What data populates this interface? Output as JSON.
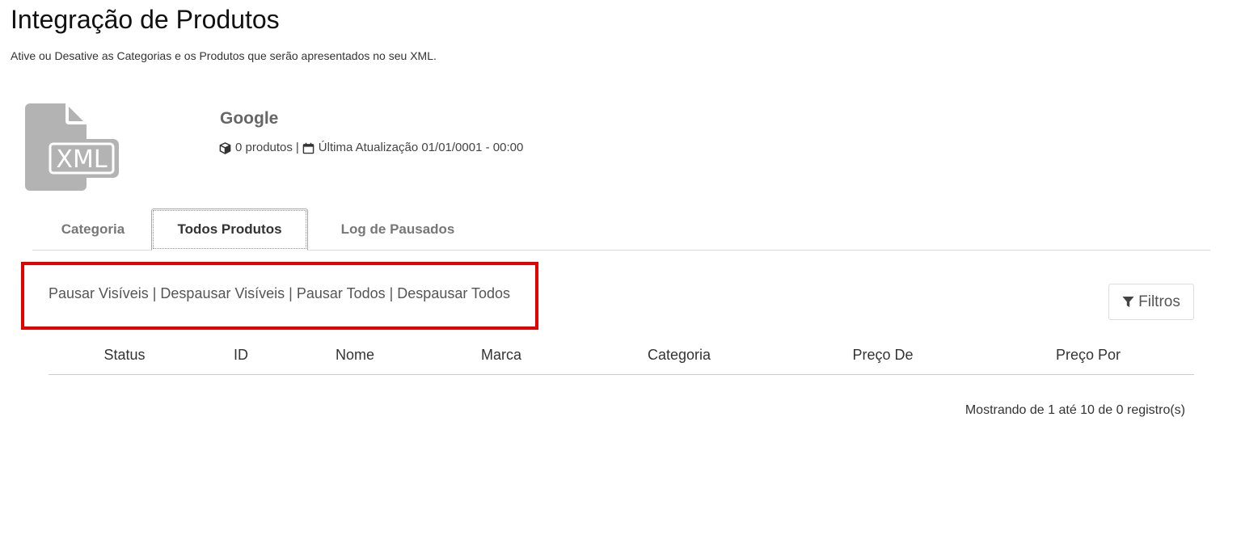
{
  "header": {
    "title": "Integração de Produtos",
    "subtitle": "Ative ou Desative as Categorias e os Produtos que serão apresentados no seu XML."
  },
  "feed": {
    "icon": "xml-file-icon",
    "icon_text": "XML",
    "name": "Google",
    "products_count": "0 produtos",
    "separator": "|",
    "last_update": "Última Atualização 01/01/0001 - 00:00"
  },
  "tabs": [
    {
      "label": "Categoria",
      "active": false
    },
    {
      "label": "Todos Produtos",
      "active": true
    },
    {
      "label": "Log de Pausados",
      "active": false
    }
  ],
  "actions": {
    "pause_visible": "Pausar Visíveis",
    "unpause_visible": "Despausar Visíveis",
    "pause_all": "Pausar Todos",
    "unpause_all": "Despausar Todos",
    "separator": "|"
  },
  "filters": {
    "label": "Filtros",
    "icon": "filter-icon"
  },
  "table": {
    "columns": [
      "Status",
      "ID",
      "Nome",
      "Marca",
      "Categoria",
      "Preço De",
      "Preço Por"
    ],
    "rows": [],
    "info": "Mostrando de 1 até 10 de 0 registro(s)"
  },
  "colors": {
    "highlight_border": "#e50000",
    "icon_gray": "#b3b3b3"
  }
}
